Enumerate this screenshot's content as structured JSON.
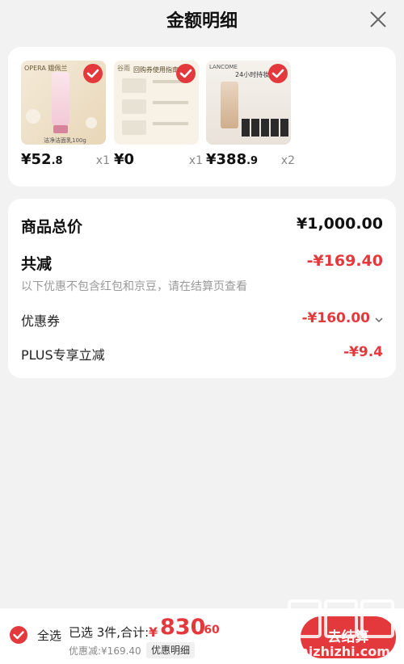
{
  "header": {
    "title": "金额明细"
  },
  "products": [
    {
      "brand": "OPERA 娥佩兰",
      "caption": "洁净洁面乳100g",
      "price_int": "¥52",
      "price_dec": ".8",
      "qty": "x1",
      "checked": true
    },
    {
      "brand": "谷雨",
      "caption": "回购券使用指南",
      "price_int": "¥0",
      "price_dec": "",
      "qty": "x1",
      "checked": true
    },
    {
      "brand": "LANCOME",
      "caption": "24小时持妆原生",
      "price_int": "¥388",
      "price_dec": ".9",
      "qty": "x2",
      "checked": true
    }
  ],
  "summary": {
    "total_label": "商品总价",
    "total_value": "¥1,000.00",
    "reduce_label": "共减",
    "reduce_value": "-¥169.40",
    "note": "以下优惠不包含红包和京豆，请在结算页查看",
    "coupon_label": "优惠券",
    "coupon_value": "-¥160.00",
    "plus_label": "PLUS专享立减",
    "plus_value": "-¥9.4"
  },
  "footer": {
    "select_all": "全选",
    "selected_text": "已选 3件,合计:",
    "total_yen": "¥",
    "total_int": "830",
    "total_dec": ".60",
    "discount_text": "优惠减:¥169.40",
    "detail_button": "优惠明细",
    "checkout_button": "去结算"
  },
  "watermark": {
    "logo": "值",
    "site": "zhizhizhi.com"
  },
  "colors": {
    "accent": "#e4393c",
    "background": "#f2f2f2"
  }
}
